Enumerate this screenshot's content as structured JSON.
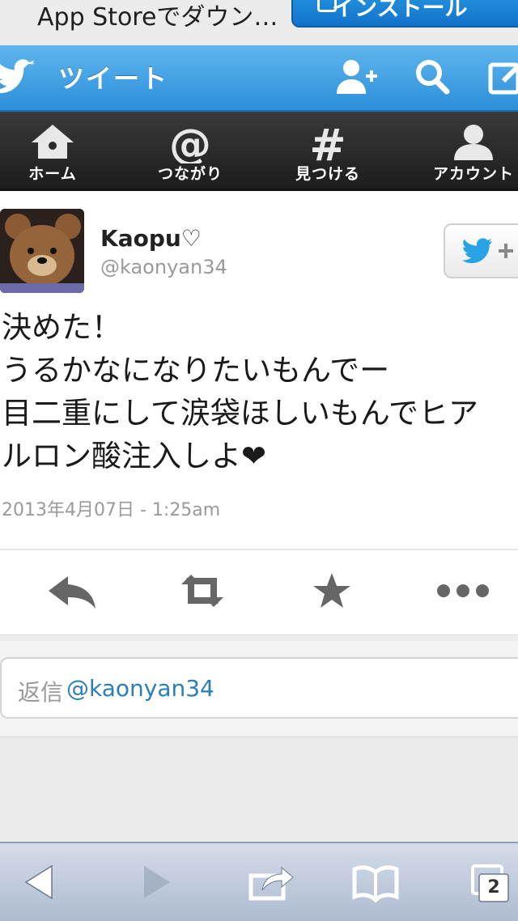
{
  "banner": {
    "text": "App Storeでダウン…",
    "button_label": "インストール"
  },
  "header": {
    "title": "ツイート"
  },
  "nav": {
    "items": [
      {
        "label": "ホーム"
      },
      {
        "label": "つながり"
      },
      {
        "label": "見つける"
      },
      {
        "label": "アカウント"
      }
    ]
  },
  "tweet": {
    "display_name": "Kaopu♡",
    "handle": "@kaonyan34",
    "text_lines": [
      "決めた！",
      "うるかなになりたいもんでー",
      "目二重にして涙袋ほしいもんでヒア",
      "ルロン酸注入しよ❤"
    ],
    "timestamp": "2013年4月07日 - 1:25am"
  },
  "reply": {
    "prefix": "返信",
    "mention": "@kaonyan34"
  },
  "toolbar": {
    "tabs_count": "2"
  },
  "colors": {
    "twitter_blue": "#2c8fd9",
    "nav_dark": "#1c1c1c",
    "link": "#2a7fb8"
  }
}
